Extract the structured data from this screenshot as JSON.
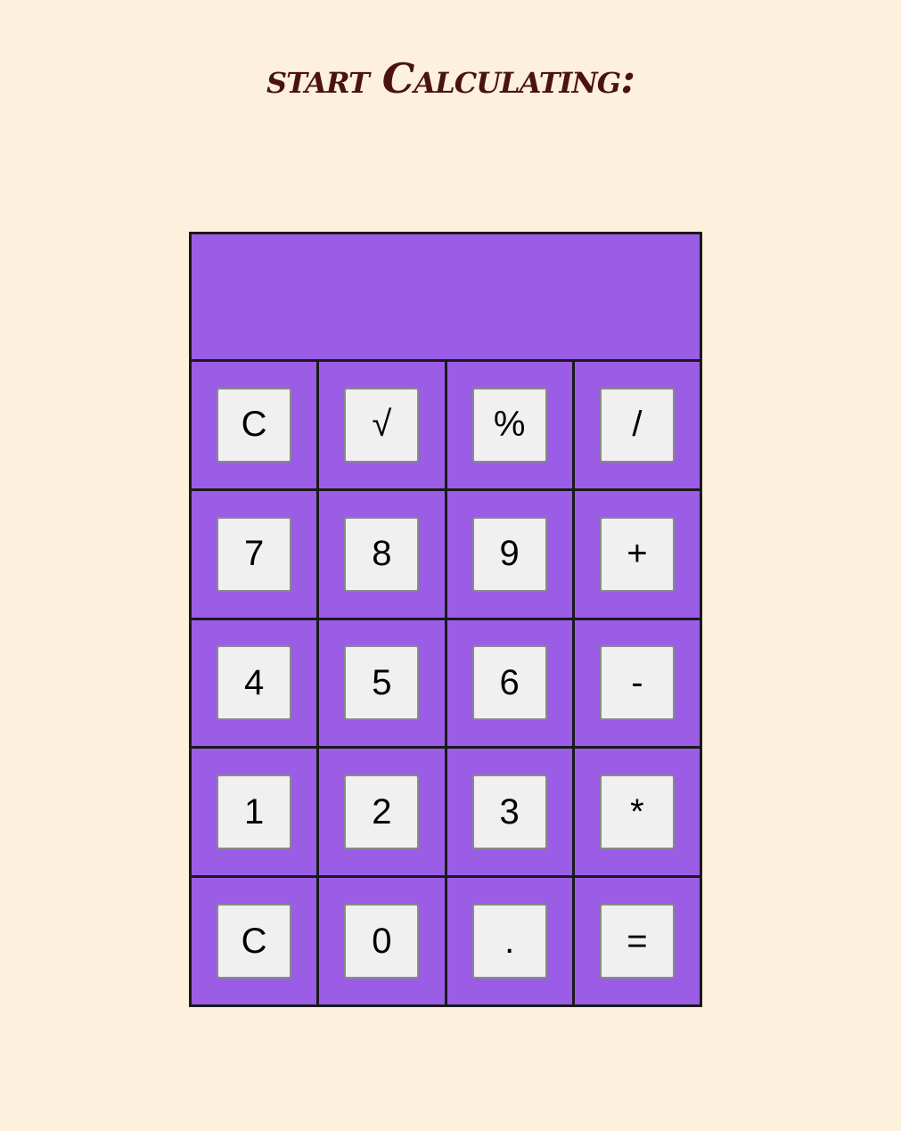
{
  "page": {
    "title": "start Calculating:"
  },
  "display": {
    "value": ""
  },
  "keys": [
    [
      {
        "label": "C",
        "name": "clear-button"
      },
      {
        "label": "√",
        "name": "sqrt-button"
      },
      {
        "label": "%",
        "name": "percent-button"
      },
      {
        "label": "/",
        "name": "divide-button"
      }
    ],
    [
      {
        "label": "7",
        "name": "digit-7-button"
      },
      {
        "label": "8",
        "name": "digit-8-button"
      },
      {
        "label": "9",
        "name": "digit-9-button"
      },
      {
        "label": "+",
        "name": "add-button"
      }
    ],
    [
      {
        "label": "4",
        "name": "digit-4-button"
      },
      {
        "label": "5",
        "name": "digit-5-button"
      },
      {
        "label": "6",
        "name": "digit-6-button"
      },
      {
        "label": "-",
        "name": "subtract-button"
      }
    ],
    [
      {
        "label": "1",
        "name": "digit-1-button"
      },
      {
        "label": "2",
        "name": "digit-2-button"
      },
      {
        "label": "3",
        "name": "digit-3-button"
      },
      {
        "label": "*",
        "name": "multiply-button"
      }
    ],
    [
      {
        "label": "C",
        "name": "clear-button-2"
      },
      {
        "label": "0",
        "name": "digit-0-button"
      },
      {
        "label": ".",
        "name": "decimal-button"
      },
      {
        "label": "=",
        "name": "equals-button"
      }
    ]
  ],
  "colors": {
    "background": "#fdf0dc",
    "title": "#4a1212",
    "calculator": "#9b5de5",
    "key": "#f0f0f0"
  }
}
